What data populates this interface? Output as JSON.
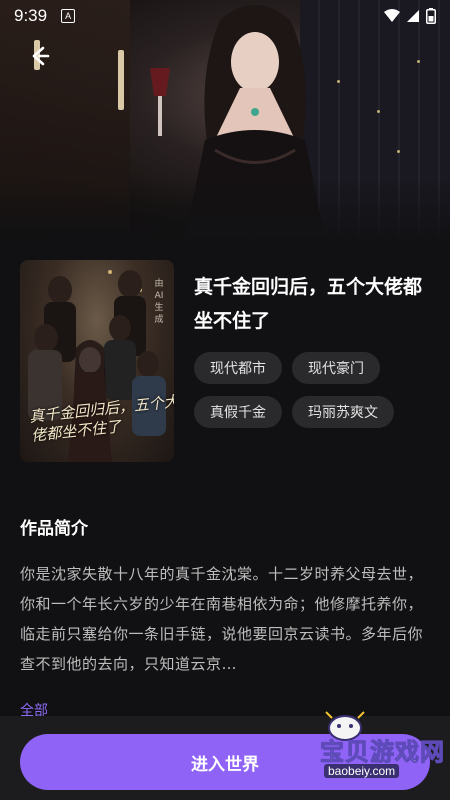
{
  "status_bar": {
    "time": "9:39",
    "notification_icon": "a-box-icon",
    "icons": [
      "wifi-icon",
      "signal-icon",
      "battery-icon"
    ]
  },
  "hero": {
    "back_icon": "back-arrow-icon"
  },
  "book": {
    "cover_title": "真千金回归后，五个大佬都坐不住了",
    "cover_stamp": "由AI生成",
    "title": "真千金回归后，五个大佬都坐不住了",
    "tags": [
      "现代都市",
      "现代豪门",
      "真假千金",
      "玛丽苏爽文"
    ]
  },
  "intro": {
    "heading": "作品简介",
    "text": "你是沈家失散十八年的真千金沈棠。十二岁时养父母去世，你和一个年长六岁的少年在南巷相依为命；他修摩托养你，临走前只塞给你一条旧手链，说他要回京云读书。多年后你查不到他的去向，只知道云京…",
    "more_label": "全部"
  },
  "action": {
    "enter_label": "进入世界"
  },
  "watermark": {
    "text": "宝贝游戏网",
    "url": "baobeiy.com",
    "mascot_icon": "gamepad-mascot-icon"
  },
  "colors": {
    "accent": "#8e63f6",
    "link": "#8d6cf2",
    "background": "#111113",
    "tag_bg": "#2a2a2d"
  }
}
